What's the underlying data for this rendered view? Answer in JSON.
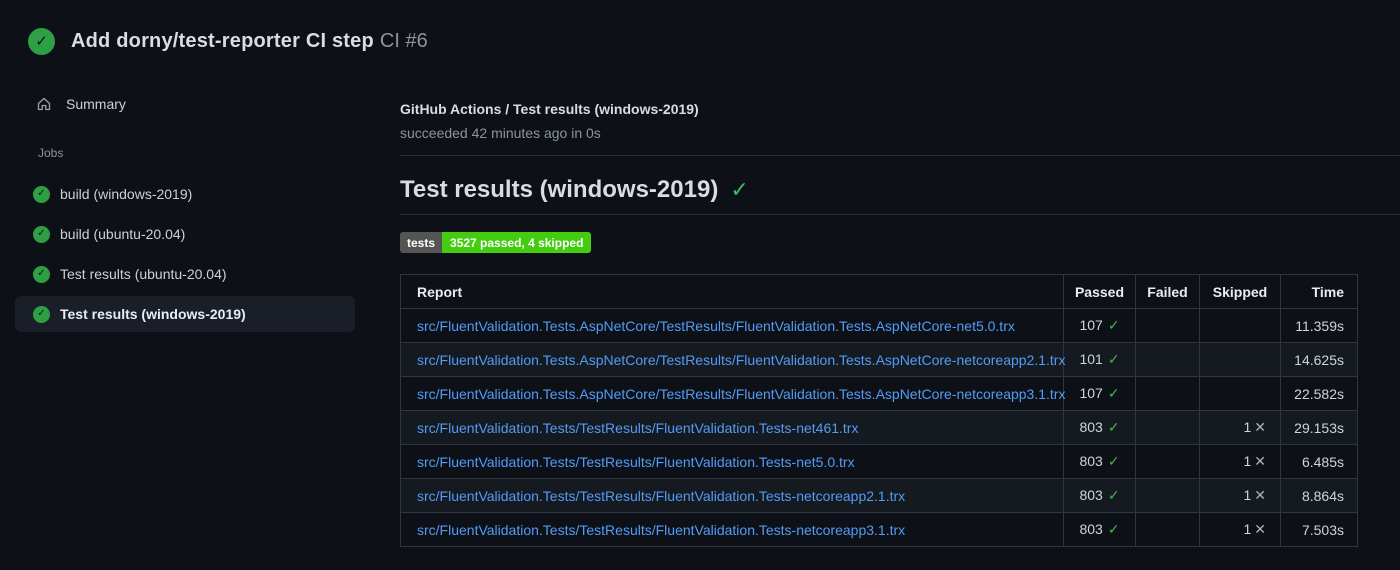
{
  "header": {
    "title": "Add dorny/test-reporter CI step",
    "run_number": "CI #6"
  },
  "sidebar": {
    "summary_label": "Summary",
    "jobs_section_label": "Jobs",
    "jobs": [
      {
        "label": "build (windows-2019)",
        "selected": false
      },
      {
        "label": "build (ubuntu-20.04)",
        "selected": false
      },
      {
        "label": "Test results (ubuntu-20.04)",
        "selected": false
      },
      {
        "label": "Test results (windows-2019)",
        "selected": true
      }
    ]
  },
  "main": {
    "breadcrumb": "GitHub Actions / Test results (windows-2019)",
    "status_line": "succeeded 42 minutes ago in 0s",
    "heading": "Test results (windows-2019)",
    "badge": {
      "label": "tests",
      "value": "3527 passed, 4 skipped"
    }
  },
  "table": {
    "headers": [
      "Report",
      "Passed",
      "Failed",
      "Skipped",
      "Time"
    ],
    "rows": [
      {
        "report": "src/FluentValidation.Tests.AspNetCore/TestResults/FluentValidation.Tests.AspNetCore-net5.0.trx",
        "passed": "107",
        "failed": "",
        "skipped": "",
        "time": "11.359s"
      },
      {
        "report": "src/FluentValidation.Tests.AspNetCore/TestResults/FluentValidation.Tests.AspNetCore-netcoreapp2.1.trx",
        "passed": "101",
        "failed": "",
        "skipped": "",
        "time": "14.625s"
      },
      {
        "report": "src/FluentValidation.Tests.AspNetCore/TestResults/FluentValidation.Tests.AspNetCore-netcoreapp3.1.trx",
        "passed": "107",
        "failed": "",
        "skipped": "",
        "time": "22.582s"
      },
      {
        "report": "src/FluentValidation.Tests/TestResults/FluentValidation.Tests-net461.trx",
        "passed": "803",
        "failed": "",
        "skipped": "1",
        "time": "29.153s"
      },
      {
        "report": "src/FluentValidation.Tests/TestResults/FluentValidation.Tests-net5.0.trx",
        "passed": "803",
        "failed": "",
        "skipped": "1",
        "time": "6.485s"
      },
      {
        "report": "src/FluentValidation.Tests/TestResults/FluentValidation.Tests-netcoreapp2.1.trx",
        "passed": "803",
        "failed": "",
        "skipped": "1",
        "time": "8.864s"
      },
      {
        "report": "src/FluentValidation.Tests/TestResults/FluentValidation.Tests-netcoreapp3.1.trx",
        "passed": "803",
        "failed": "",
        "skipped": "1",
        "time": "7.503s"
      }
    ]
  },
  "icons": {
    "check_glyph": "✓",
    "cross_glyph": "✕"
  },
  "colors": {
    "background": "#0d1117",
    "success_green": "#2ea043",
    "check_green": "#3fb950",
    "badge_label_bg": "#555555",
    "badge_value_bg": "#44cc11",
    "link_blue": "#539bf5",
    "muted_text": "#8b949e",
    "table_border": "#30363d",
    "alt_row_bg": "#151a21"
  }
}
